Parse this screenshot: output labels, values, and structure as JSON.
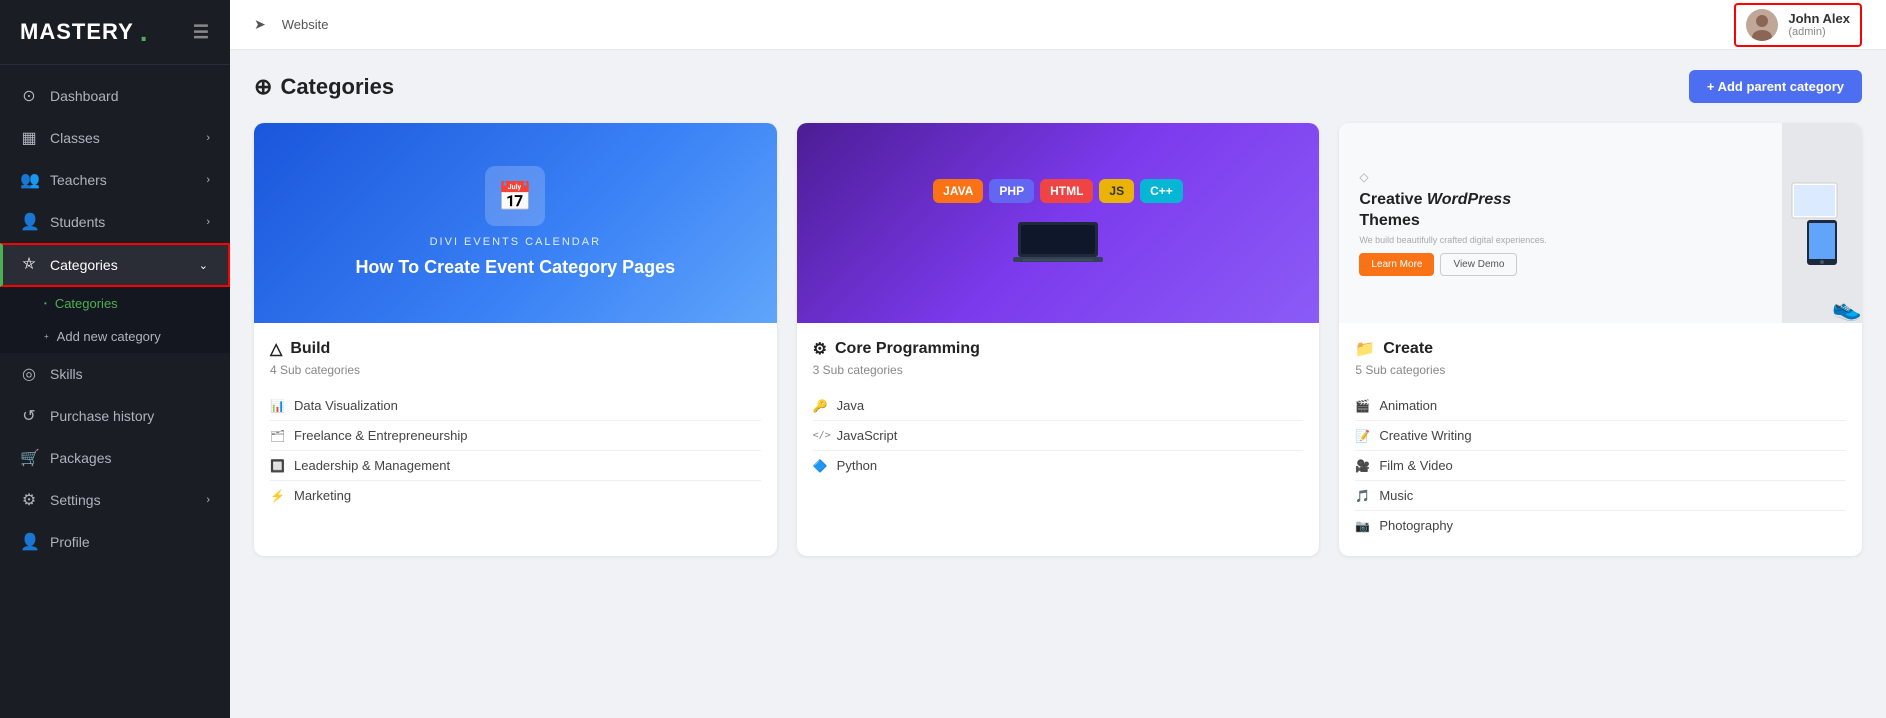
{
  "app": {
    "name": "MASTERY",
    "dot": "."
  },
  "sidebar": {
    "nav_items": [
      {
        "id": "dashboard",
        "label": "Dashboard",
        "icon": "⊙",
        "has_arrow": false
      },
      {
        "id": "classes",
        "label": "Classes",
        "icon": "▦",
        "has_arrow": true
      },
      {
        "id": "teachers",
        "label": "Teachers",
        "icon": "👥",
        "has_arrow": true
      },
      {
        "id": "students",
        "label": "Students",
        "icon": "👤",
        "has_arrow": true
      },
      {
        "id": "categories",
        "label": "Categories",
        "icon": "⛤",
        "has_arrow": true,
        "active": true,
        "has_border": true
      }
    ],
    "sub_nav": [
      {
        "id": "categories-sub",
        "label": "Categories",
        "active": true,
        "has_arrow_annotation": true
      },
      {
        "id": "add-category",
        "label": "Add new category"
      }
    ],
    "bottom_nav": [
      {
        "id": "skills",
        "label": "Skills",
        "icon": "◎"
      },
      {
        "id": "purchase-history",
        "label": "Purchase history",
        "icon": "↺"
      },
      {
        "id": "packages",
        "label": "Packages",
        "icon": "🛒"
      },
      {
        "id": "settings",
        "label": "Settings",
        "icon": "⚙",
        "has_arrow": true
      },
      {
        "id": "profile",
        "label": "Profile",
        "icon": "👤"
      }
    ]
  },
  "topbar": {
    "breadcrumb": "Website",
    "breadcrumb_icon": "➤",
    "user": {
      "name": "John Alex",
      "role": "(admin)"
    }
  },
  "page": {
    "title": "Categories",
    "title_icon": "⊕",
    "add_button": "+ Add parent category"
  },
  "categories": [
    {
      "id": "build",
      "name": "Build",
      "name_icon": "△",
      "sub_count": "4 Sub categories",
      "theme": "blue",
      "image_text_line1": "DIVI EVENTS CALENDAR",
      "image_text_line2": "How To Create Event Category Pages",
      "items": [
        {
          "icon": "📊",
          "label": "Data Visualization"
        },
        {
          "icon": "🗂",
          "label": "Freelance & Entrepreneurship"
        },
        {
          "icon": "🔲",
          "label": "Leadership & Management"
        },
        {
          "icon": "⚡",
          "label": "Marketing"
        }
      ]
    },
    {
      "id": "core-programming",
      "name": "Core Programming",
      "name_icon": "⚙",
      "sub_count": "3 Sub categories",
      "theme": "purple",
      "badges": [
        {
          "label": "JAVA",
          "class": "badge-java"
        },
        {
          "label": "PHP",
          "class": "badge-php"
        },
        {
          "label": "HTML",
          "class": "badge-html"
        },
        {
          "label": "JS",
          "class": "badge-js"
        },
        {
          "label": "C++",
          "class": "badge-cpp"
        }
      ],
      "items": [
        {
          "icon": "🔑",
          "label": "Java"
        },
        {
          "icon": "</>",
          "label": "JavaScript"
        },
        {
          "icon": "🔷",
          "label": "Python"
        }
      ]
    },
    {
      "id": "create",
      "name": "Create",
      "name_icon": "📁",
      "sub_count": "5 Sub categories",
      "theme": "light",
      "image_title": "Creative WordPress Themes",
      "image_subtitle": "We build beautifully crafted digital experiences.",
      "items": [
        {
          "icon": "🎬",
          "label": "Animation"
        },
        {
          "icon": "📝",
          "label": "Creative Writing"
        },
        {
          "icon": "🎥",
          "label": "Film & Video"
        },
        {
          "icon": "🎵",
          "label": "Music"
        },
        {
          "icon": "📷",
          "label": "Photography"
        }
      ]
    }
  ]
}
